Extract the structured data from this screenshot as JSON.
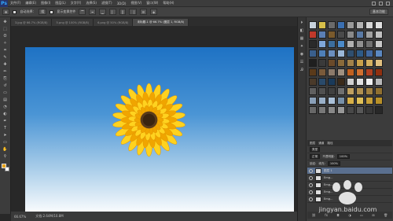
{
  "app": {
    "logo": "Ps"
  },
  "menubar": {
    "items": [
      "文件(F)",
      "编辑(E)",
      "图像(I)",
      "图层(L)",
      "文字(Y)",
      "选择(S)",
      "滤镜(T)",
      "3D(D)",
      "视图(V)",
      "窗口(W)",
      "帮助(H)"
    ]
  },
  "options": {
    "auto_select_label": "自动选择：",
    "auto_select_value": "组",
    "show_transform_label": "显示变换控件",
    "workspace": "基本功能"
  },
  "tabs": [
    {
      "label": "3.jpg @ 66.7% (RGB/8)",
      "active": false
    },
    {
      "label": "5.png @ 100% (RGB/8)",
      "active": false
    },
    {
      "label": "6.png @ 50% (RGB/8)",
      "active": false
    },
    {
      "label": "未标题-1 @ 66.7% (图层 1, RGB/8)",
      "active": true
    }
  ],
  "toolbar": {
    "tools": [
      "move-tool-icon",
      "marquee-tool-icon",
      "lasso-tool-icon",
      "magic-wand-tool-icon",
      "crop-tool-icon",
      "eyedropper-tool-icon",
      "healing-brush-tool-icon",
      "brush-tool-icon",
      "clone-stamp-tool-icon",
      "history-brush-tool-icon",
      "eraser-tool-icon",
      "gradient-tool-icon",
      "blur-tool-icon",
      "dodge-tool-icon",
      "pen-tool-icon",
      "type-tool-icon",
      "path-selection-tool-icon",
      "shape-tool-icon",
      "hand-tool-icon",
      "zoom-tool-icon"
    ],
    "tool_glyphs": [
      "✥",
      "⬚",
      "ʘ",
      "✧",
      "⌗",
      "✎",
      "✚",
      "✏",
      "⎘",
      "↺",
      "▭",
      "▤",
      "◔",
      "◐",
      "✒",
      "T",
      "➤",
      "▭",
      "✋",
      "⚲"
    ],
    "fg_color": "#e8a317",
    "bg_color": "#ffffff"
  },
  "canvas": {
    "sky_top": "#1e72c4",
    "sky_bottom": "#ffffff",
    "petal_light": "#ffd21f",
    "petal_dark": "#f0a500",
    "center": "#5a3a1a"
  },
  "status": {
    "zoom": "66.67%",
    "doc_info": "文档:2.64M/10.8M"
  },
  "styles_panel": {
    "swatches": [
      "#c8d2dc",
      "#d8c04a",
      "#6b6b6b",
      "#3b6fb0",
      "#9a9a9a",
      "#b3b3b3",
      "#d6d6d6",
      "#e0e0e0",
      "#c0392b",
      "#5b7fb5",
      "#7a5a2c",
      "#4a4a4a",
      "#8a8a8a",
      "#5a7aa5",
      "#a0a0a0",
      "#c0c0c0",
      "#2a2a2a",
      "#7fa7d9",
      "#3c6e9e",
      "#4b8ac9",
      "#b0b0b0",
      "#909090",
      "#707070",
      "#c8c8c8",
      "#3a5f8c",
      "#4e7fb8",
      "#6b8fbf",
      "#9bb8d8",
      "#2f4f6f",
      "#2e5a86",
      "#4169a0",
      "#5b88c0",
      "#1f1f1f",
      "#3a3a3a",
      "#6a4a2a",
      "#8a6a3a",
      "#a3824a",
      "#c9a04a",
      "#d4b060",
      "#e0c080",
      "#5a3a1a",
      "#7a5a3a",
      "#8c7a6a",
      "#a09080",
      "#c06020",
      "#d07030",
      "#b04020",
      "#903010",
      "#4a3a2a",
      "#2a4a6a",
      "#1a3a5a",
      "#3a2a1a",
      "#d0d0d0",
      "#e0e0e0",
      "#f0f0f0",
      "#b8b8b8",
      "#606060",
      "#505050",
      "#404040",
      "#707070",
      "#c0a060",
      "#b09050",
      "#a08040",
      "#907030",
      "#8aa0b8",
      "#9ab0c8",
      "#aac0d8",
      "#7890a8",
      "#d8b048",
      "#e0c058",
      "#c8a038",
      "#b89028",
      "#686868",
      "#787878",
      "#888888",
      "#989898",
      "#484848",
      "#585858",
      "#383838",
      "#282828"
    ]
  },
  "layers_panel": {
    "tabs": [
      "图层",
      "通道",
      "路径"
    ],
    "filter": "类型",
    "blend_mode": "正常",
    "opacity_label": "不透明度:",
    "opacity_value": "100%",
    "lock_label": "锁定:",
    "fill_label": "填充:",
    "fill_value": "100%",
    "layers": [
      {
        "name": "图层 1",
        "selected": true
      },
      {
        "name": "Emg...",
        "selected": false
      },
      {
        "name": "Emg...",
        "selected": false
      },
      {
        "name": "Emg...",
        "selected": false
      },
      {
        "name": "Emg...",
        "selected": false
      }
    ]
  },
  "right_strip": {
    "icons": [
      "⏵",
      "◧",
      "▦",
      "✦",
      "◉",
      "☰",
      "Ꭿ"
    ]
  },
  "watermark": {
    "text": "jingyan.baidu.com"
  }
}
